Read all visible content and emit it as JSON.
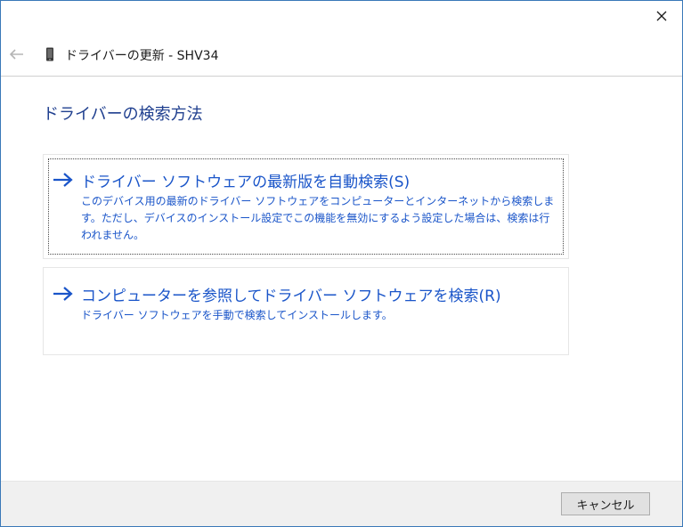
{
  "window": {
    "title": "ドライバーの更新 - SHV34"
  },
  "icons": {
    "close": "close-icon",
    "back": "back-arrow-icon",
    "device": "phone-device-icon",
    "option_arrow": "right-arrow-icon"
  },
  "main": {
    "heading": "ドライバーの検索方法",
    "options": [
      {
        "title": "ドライバー ソフトウェアの最新版を自動検索(S)",
        "description": "このデバイス用の最新のドライバー ソフトウェアをコンピューターとインターネットから検索します。ただし、デバイスのインストール設定でこの機能を無効にするよう設定した場合は、検索は行われません。"
      },
      {
        "title": "コンピューターを参照してドライバー ソフトウェアを検索(R)",
        "description": "ドライバー ソフトウェアを手動で検索してインストールします。"
      }
    ]
  },
  "footer": {
    "cancel_label": "キャンセル"
  },
  "colors": {
    "accent": "#1a55c9",
    "heading": "#1f3f8f",
    "window_border": "#3a78b8",
    "footer_bg": "#f0f0f0"
  }
}
